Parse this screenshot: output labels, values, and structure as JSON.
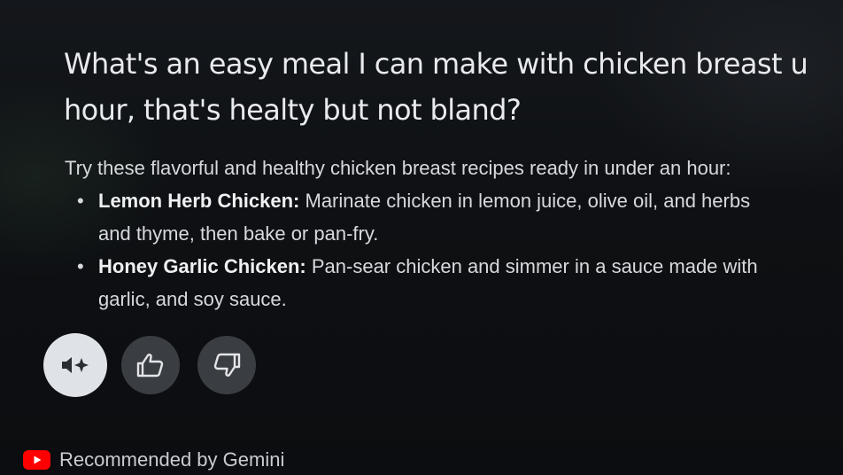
{
  "question": {
    "line1": "What's an easy meal I can make with chicken breast u",
    "line2": "hour, that's healty but not bland?"
  },
  "answer": {
    "intro": "Try these flavorful and healthy chicken breast recipes ready in under an hour:",
    "recipes": [
      {
        "bullet": "•",
        "name": "Lemon Herb Chicken:",
        "line1": " Marinate chicken in lemon juice, olive oil, and herbs",
        "line2": "and thyme, then bake or pan-fry."
      },
      {
        "bullet": "•",
        "name": "Honey Garlic Chicken:",
        "line1": " Pan-sear chicken and simmer in a sauce made with",
        "line2": "garlic, and soy sauce."
      }
    ]
  },
  "actions": {
    "listen_icon": "speaker-sparkle-icon",
    "like_icon": "thumbs-up-icon",
    "dislike_icon": "thumbs-down-icon"
  },
  "footer": {
    "logo_icon": "youtube-logo-icon",
    "text": "Recommended by Gemini"
  },
  "colors": {
    "background": "#0d0f12",
    "text_primary": "#e8eaed",
    "listen_button": "#dfe3e8",
    "feedback_button": "#3a3d42",
    "youtube_red": "#ff0000"
  }
}
